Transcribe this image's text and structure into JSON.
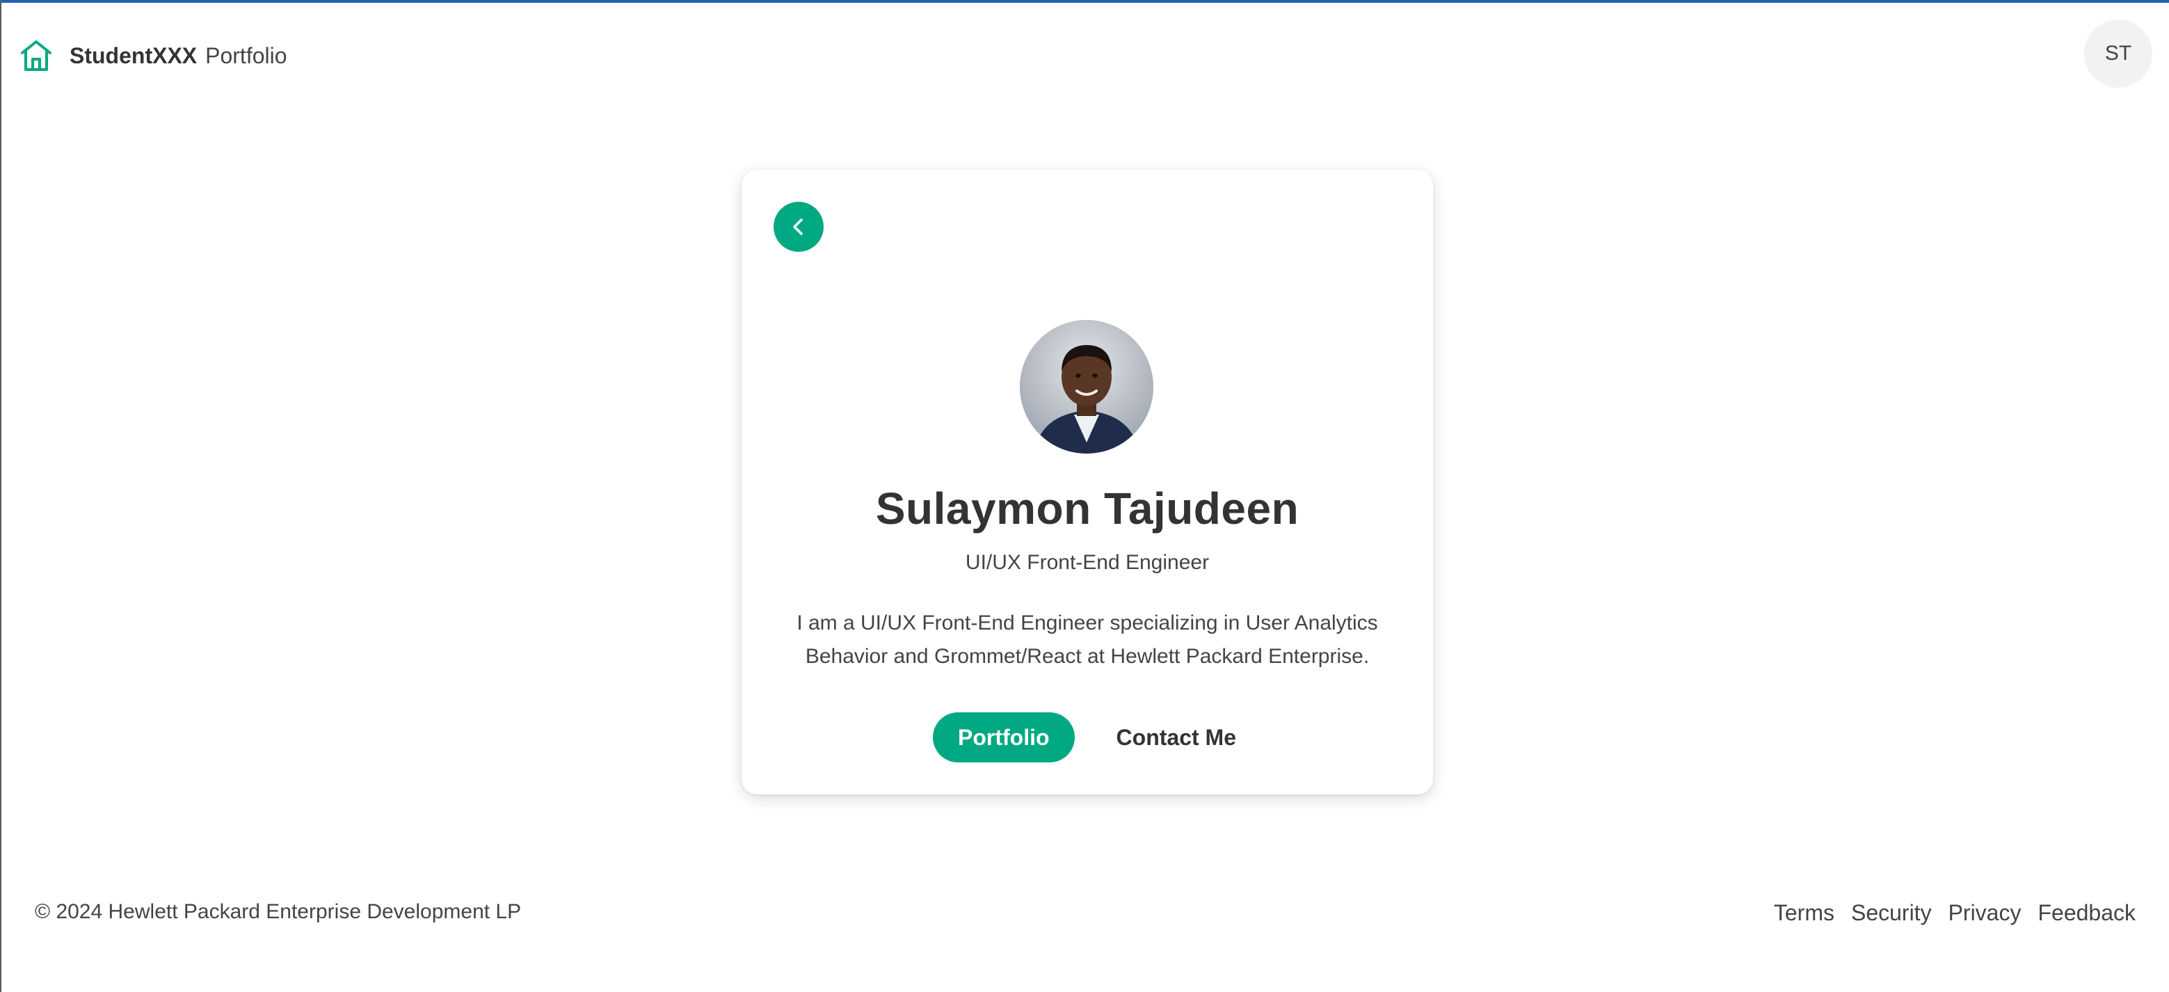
{
  "header": {
    "brand_name": "StudentXXX",
    "brand_sub": "Portfolio",
    "brand_icon": "home-icon",
    "user_initials": "ST"
  },
  "card": {
    "back_icon": "chevron-left-icon",
    "name": "Sulaymon Tajudeen",
    "role": "UI/UX Front-End Engineer",
    "bio": "I am a UI/UX Front-End Engineer specializing in User Analytics Behavior and Grommet/React at Hewlett Packard Enterprise.",
    "primary_button": "Portfolio",
    "secondary_button": "Contact Me"
  },
  "footer": {
    "copyright": "© 2024 Hewlett Packard Enterprise Development LP",
    "links": [
      "Terms",
      "Security",
      "Privacy",
      "Feedback"
    ]
  },
  "colors": {
    "brand_green": "#01a982",
    "top_accent": "#1f63b0",
    "text": "#333333"
  }
}
